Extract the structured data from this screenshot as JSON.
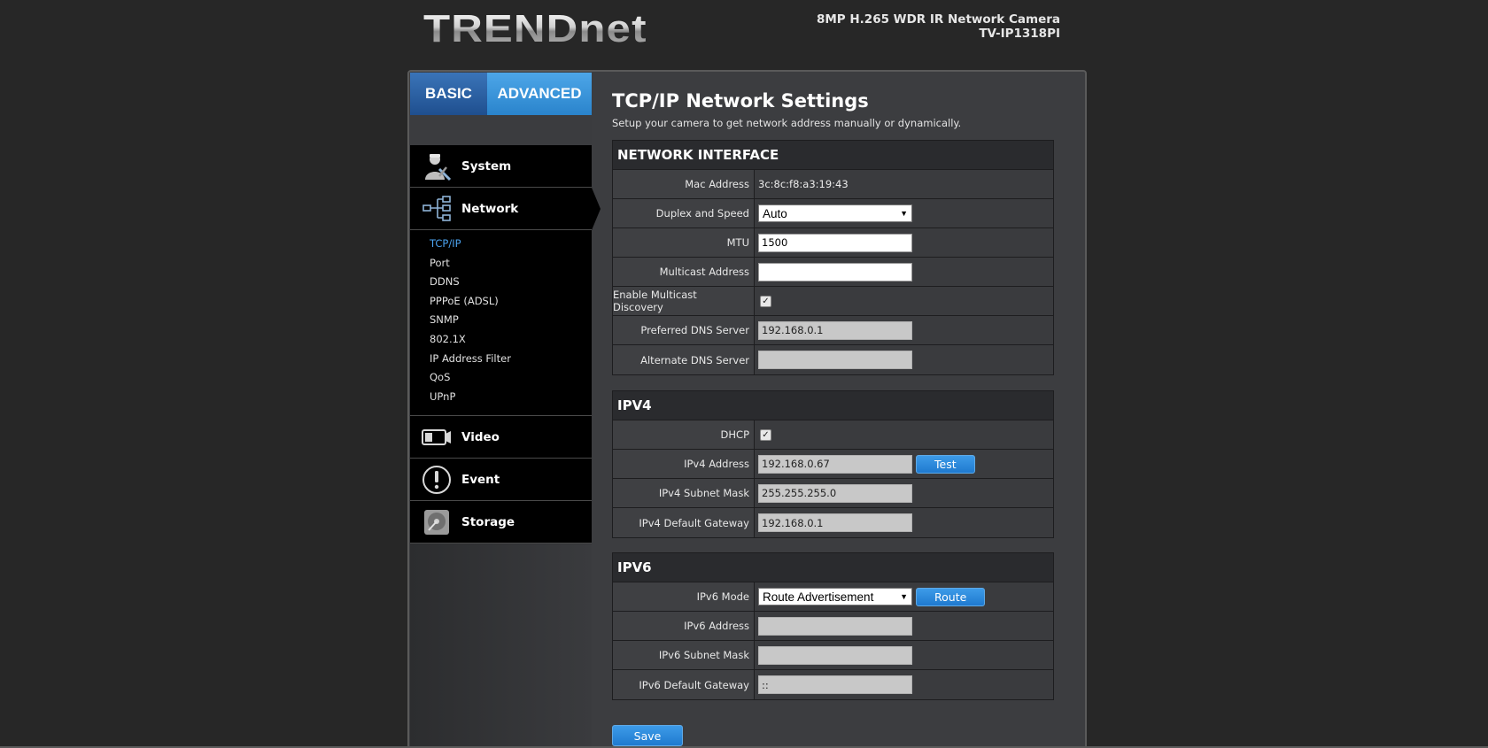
{
  "header": {
    "logo": "TRENDnet",
    "model_line1": "8MP H.265 WDR IR Network Camera",
    "model_line2": "TV-IP1318PI"
  },
  "tabs": {
    "basic": "BASIC",
    "advanced": "ADVANCED"
  },
  "sidebar": {
    "system": "System",
    "network": "Network",
    "network_items": [
      "TCP/IP",
      "Port",
      "DDNS",
      "PPPoE (ADSL)",
      "SNMP",
      "802.1X",
      "IP Address Filter",
      "QoS",
      "UPnP"
    ],
    "video": "Video",
    "event": "Event",
    "storage": "Storage"
  },
  "page": {
    "title": "TCP/IP Network Settings",
    "subtitle": "Setup your camera to get network address manually or dynamically."
  },
  "network_interface": {
    "heading": "NETWORK INTERFACE",
    "mac_label": "Mac Address",
    "mac_value": "3c:8c:f8:a3:19:43",
    "duplex_label": "Duplex and Speed",
    "duplex_value": "Auto",
    "mtu_label": "MTU",
    "mtu_value": "1500",
    "multicast_label": "Multicast Address",
    "multicast_value": "",
    "multicast_discovery_label": "Enable Multicast Discovery",
    "multicast_discovery_checked": true,
    "pref_dns_label": "Preferred DNS Server",
    "pref_dns_value": "192.168.0.1",
    "alt_dns_label": "Alternate DNS Server",
    "alt_dns_value": ""
  },
  "ipv4": {
    "heading": "IPV4",
    "dhcp_label": "DHCP",
    "dhcp_checked": true,
    "addr_label": "IPv4 Address",
    "addr_value": "192.168.0.67",
    "test_button": "Test",
    "mask_label": "IPv4 Subnet Mask",
    "mask_value": "255.255.255.0",
    "gw_label": "IPv4 Default Gateway",
    "gw_value": "192.168.0.1"
  },
  "ipv6": {
    "heading": "IPV6",
    "mode_label": "IPv6 Mode",
    "mode_value": "Route Advertisement",
    "route_button": "Route",
    "addr_label": "IPv6 Address",
    "addr_value": "",
    "mask_label": "IPv6 Subnet Mask",
    "mask_value": "",
    "gw_label": "IPv6 Default Gateway",
    "gw_value": "::"
  },
  "save_button": "Save",
  "check_mark": "✓",
  "chevron": "⌄"
}
